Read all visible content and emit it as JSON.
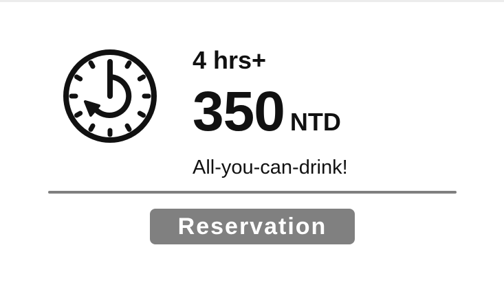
{
  "offer": {
    "duration": "4 hrs+",
    "price_amount": "350",
    "price_currency": "NTD",
    "tagline": "All-you-can-drink!"
  },
  "actions": {
    "reservation_label": "Reservation"
  },
  "icons": {
    "timer": "clock-countdown-icon"
  },
  "colors": {
    "text": "#111111",
    "divider": "#7f7f7f",
    "button_bg": "#808080",
    "button_text": "#ffffff",
    "background": "#ffffff"
  }
}
